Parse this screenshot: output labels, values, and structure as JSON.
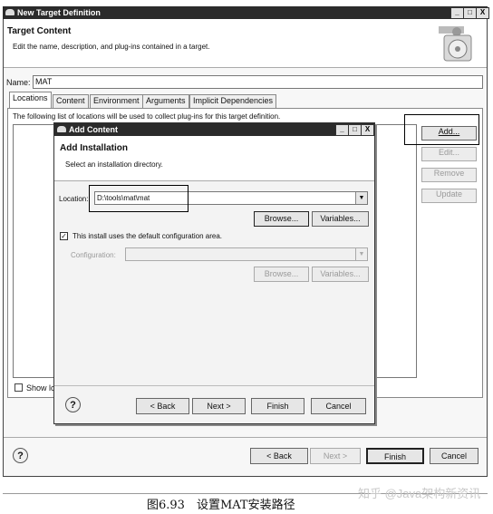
{
  "main_window": {
    "title": "New Target Definition",
    "controls": [
      "_",
      "□",
      "X"
    ],
    "header_title": "Target Content",
    "header_desc": "Edit the name, description, and plug-ins contained in a target.",
    "name_label": "Name:",
    "name_value": "MAT",
    "tabs": [
      "Locations",
      "Content",
      "Environment",
      "Arguments",
      "Implicit Dependencies"
    ],
    "locations_desc": "The following list of locations will be used to collect plug-ins for this target definition.",
    "side_buttons": [
      "Add...",
      "Edit...",
      "Remove",
      "Update"
    ],
    "show_label": "Show lc",
    "footer_buttons": [
      "< Back",
      "Next >",
      "Finish",
      "Cancel"
    ],
    "help_glyph": "?"
  },
  "dialog": {
    "title": "Add Content",
    "controls": [
      "_",
      "□",
      "X"
    ],
    "header_title": "Add Installation",
    "header_desc": "Select an installation directory.",
    "location_label": "Location:",
    "location_value": "D:\\tools\\mat\\mat",
    "browse_label": "Browse...",
    "variables_label": "Variables...",
    "checkbox_label": "This install uses the default configuration area.",
    "configuration_label": "Configuration:",
    "browse2_label": "Browse...",
    "variables2_label": "Variables...",
    "footer_buttons": [
      "< Back",
      "Next >",
      "Finish",
      "Cancel"
    ],
    "help_glyph": "?"
  },
  "caption": "图6.93　设置MAT安装路径",
  "watermark": "知乎 @Java架构新资讯"
}
